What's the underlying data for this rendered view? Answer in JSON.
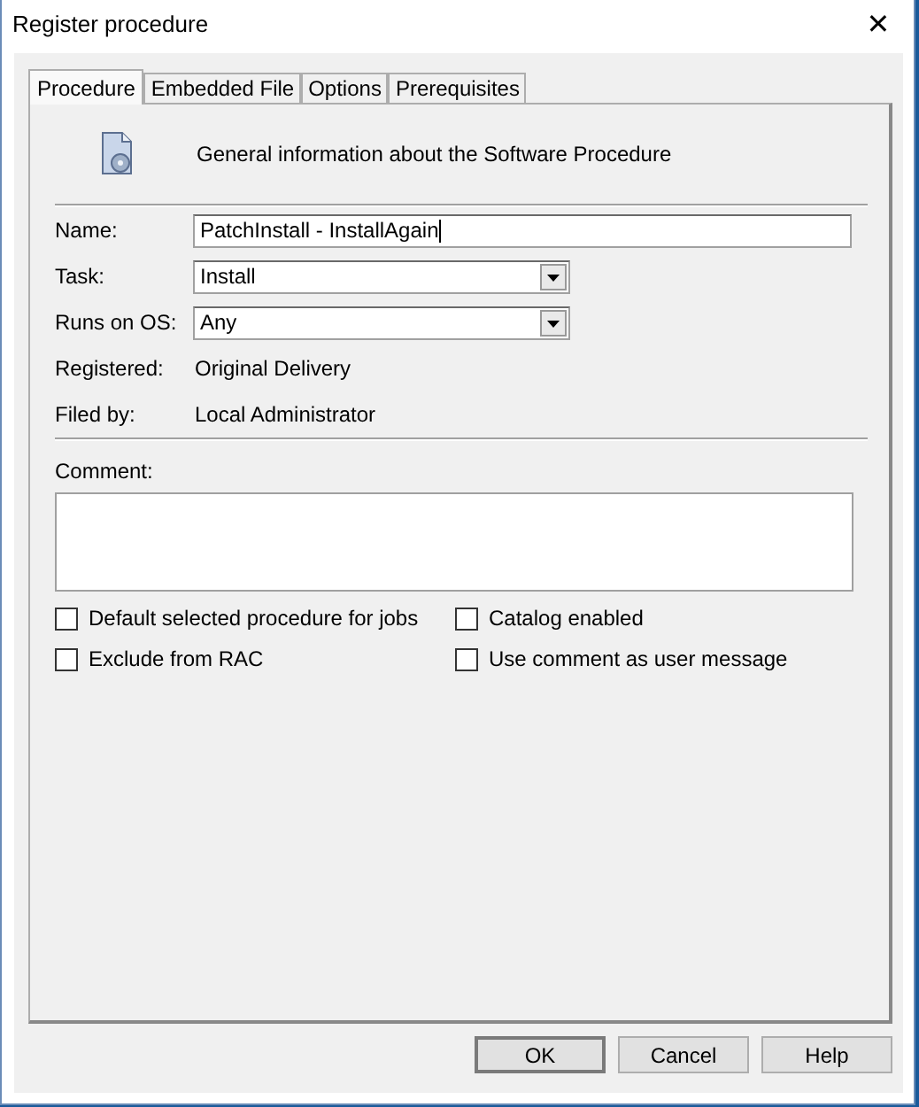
{
  "window": {
    "title": "Register procedure",
    "close": "✕"
  },
  "tabs": [
    {
      "label": "Procedure",
      "selected": true
    },
    {
      "label": "Embedded File",
      "selected": false
    },
    {
      "label": "Options",
      "selected": false
    },
    {
      "label": "Prerequisites",
      "selected": false
    }
  ],
  "header": {
    "text": "General information about the Software Procedure"
  },
  "fields": [
    {
      "kind": "text",
      "label": "Name:",
      "value": "PatchInstall - InstallAgain"
    },
    {
      "kind": "dropdown",
      "label": "Task:",
      "value": "Install"
    },
    {
      "kind": "dropdown",
      "label": "Runs on OS:",
      "value": "Any"
    },
    {
      "kind": "info",
      "label": "Registered:",
      "value": "Original Delivery"
    },
    {
      "kind": "info",
      "label": "Filed by:",
      "value": "Local Administrator"
    }
  ],
  "comment": {
    "label": "Comment:"
  },
  "checkboxes": [
    {
      "label": "Default selected procedure for jobs",
      "checked": false
    },
    {
      "label": "Catalog enabled",
      "checked": false
    },
    {
      "label": "Exclude from RAC",
      "checked": false
    },
    {
      "label": "Use comment as user message",
      "checked": false
    }
  ],
  "buttons": [
    "OK",
    "Cancel",
    "Help"
  ]
}
